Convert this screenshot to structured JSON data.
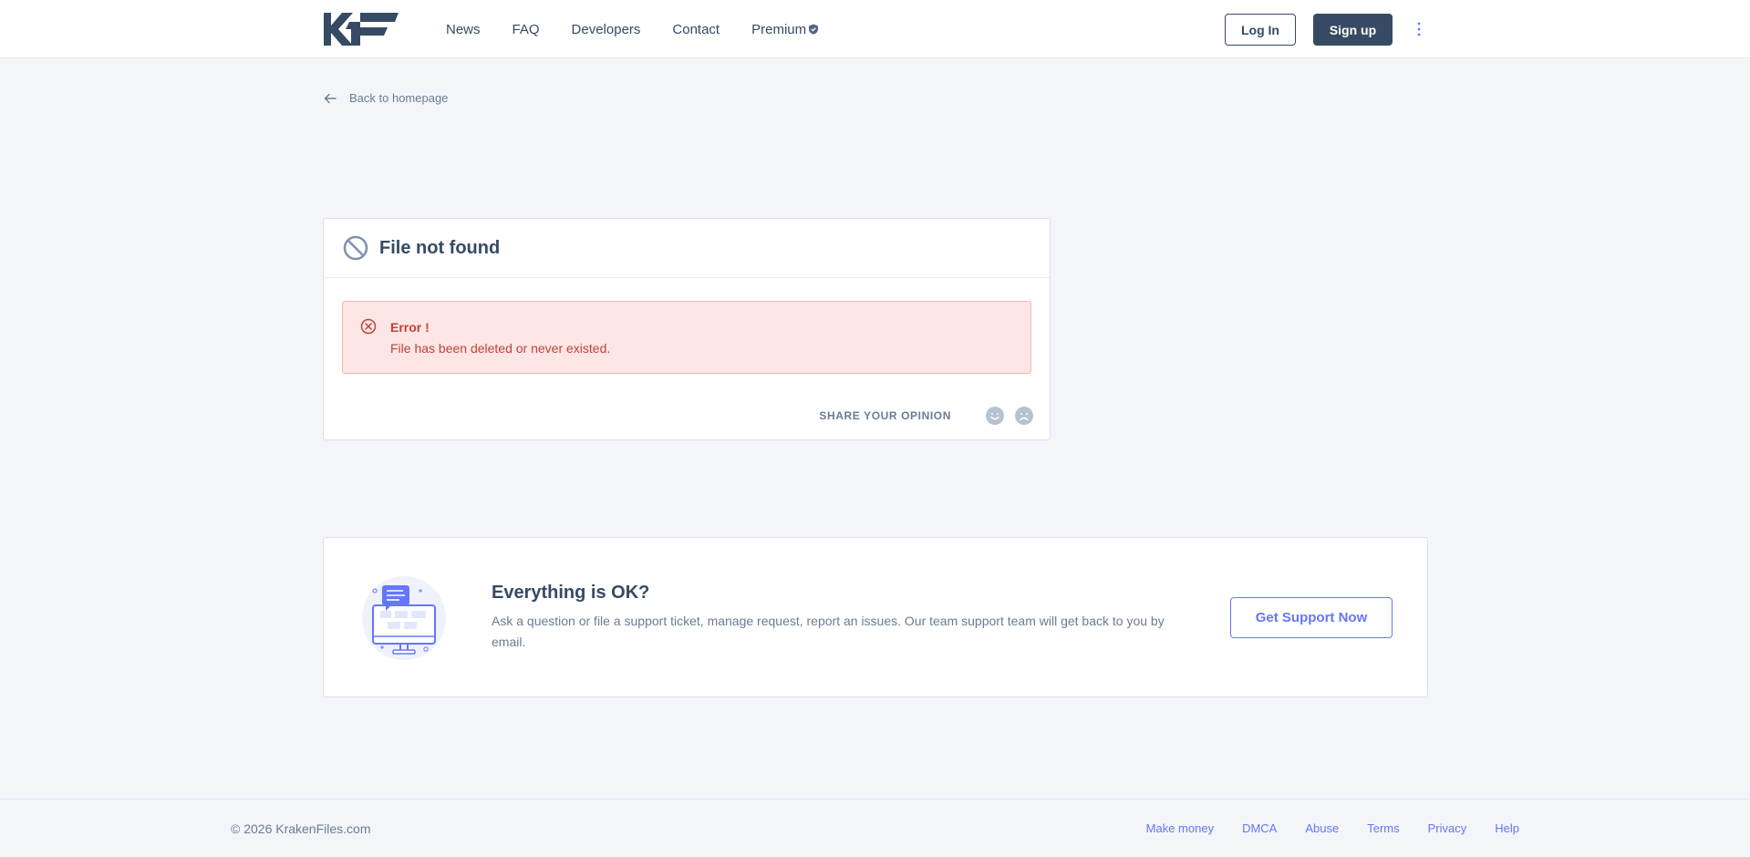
{
  "header": {
    "logo": "KF",
    "nav": [
      "News",
      "FAQ",
      "Developers",
      "Contact",
      "Premium"
    ],
    "login_label": "Log In",
    "signup_label": "Sign up"
  },
  "back_link": "Back to homepage",
  "card": {
    "title": "File not found",
    "alert_title": "Error !",
    "alert_text": "File has been deleted or never existed.",
    "opinion_label": "SHARE YOUR OPINION"
  },
  "support": {
    "title": "Everything is OK?",
    "text": "Ask a question or file a support ticket, manage request, report an issues. Our team support team will get back to you by email.",
    "button_label": "Get Support Now"
  },
  "footer": {
    "copyright": "© 2026 KrakenFiles.com",
    "links": [
      "Make money",
      "DMCA",
      "Abuse",
      "Terms",
      "Privacy",
      "Help"
    ]
  },
  "colors": {
    "brand": "#364a63",
    "accent": "#6576ff",
    "danger": "#c2413a",
    "danger_bg": "#fde6e5",
    "background": "#f4f5f9"
  }
}
